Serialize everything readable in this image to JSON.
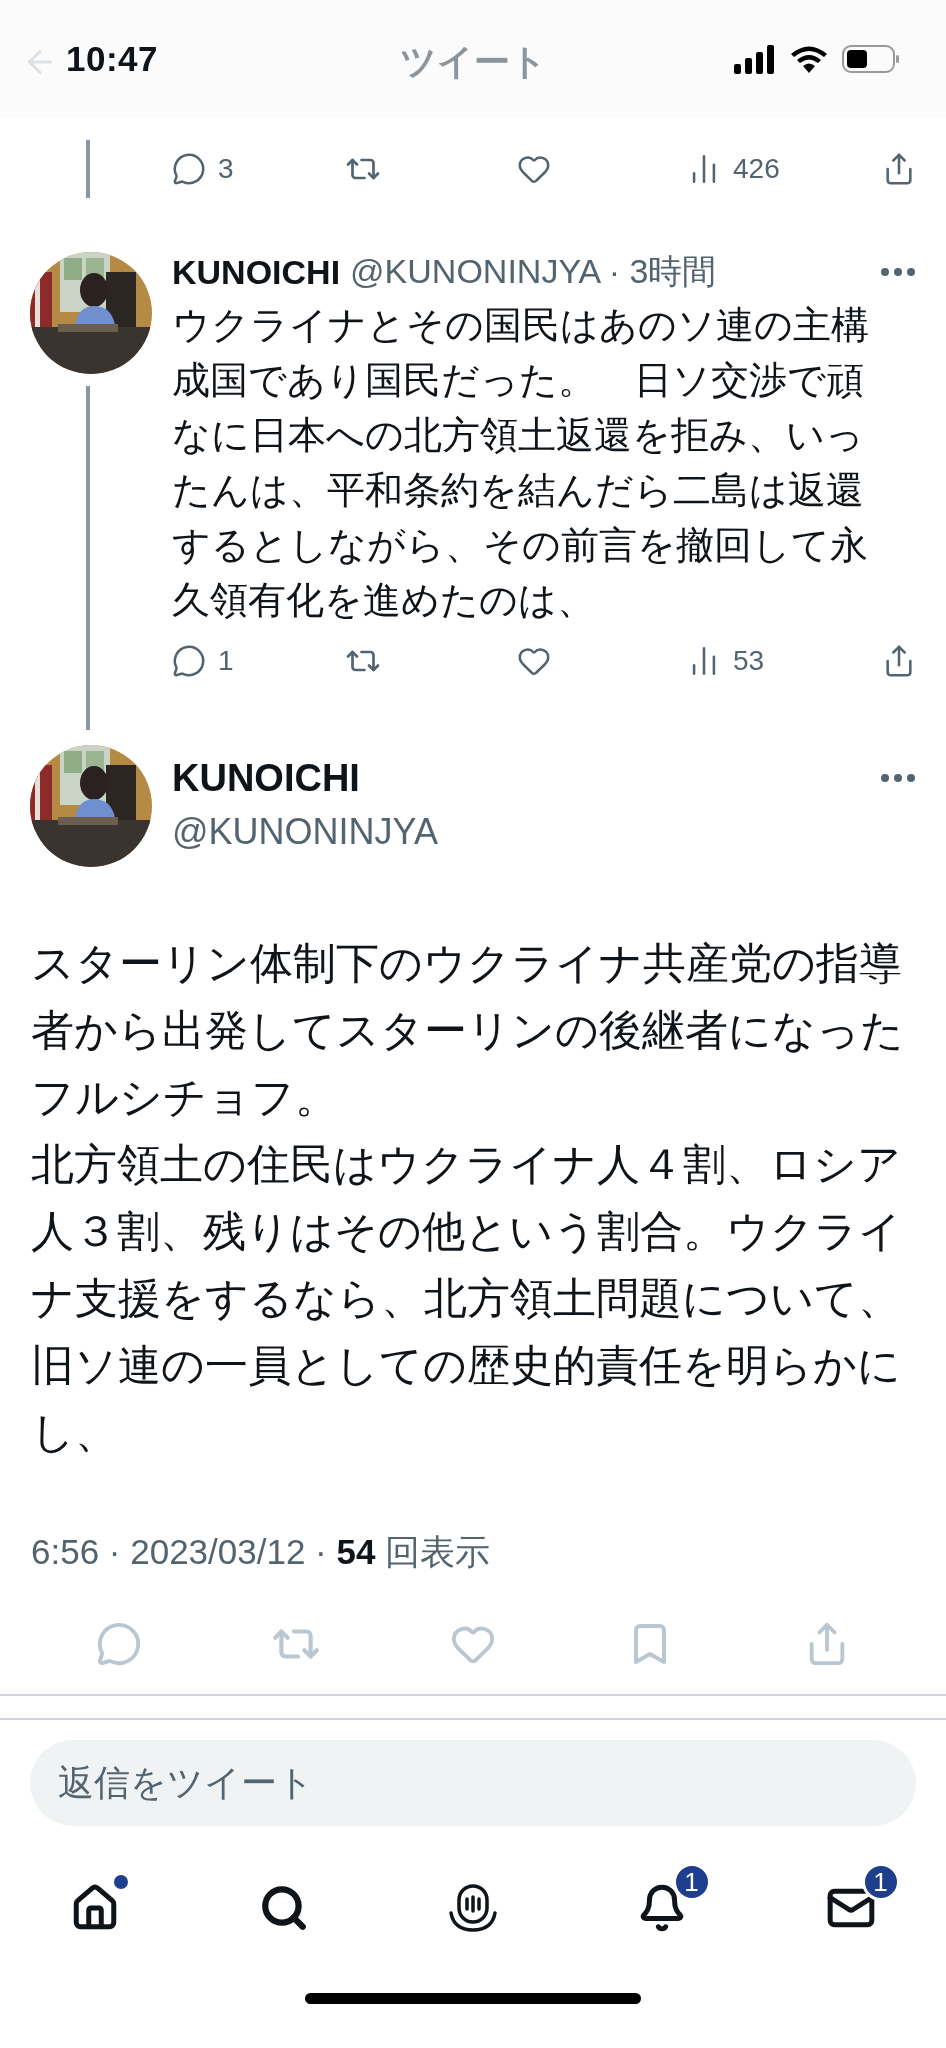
{
  "status_bar": {
    "time": "10:47"
  },
  "header": {
    "title": "ツイート"
  },
  "thread": [
    {
      "kind": "partial",
      "actions": {
        "replies": "3",
        "views": "426"
      }
    },
    {
      "kind": "reply",
      "name": "KUNOICHI",
      "meta": "@KUNONINJYA · 3時間",
      "text": "ウクライナとその国民はあのソ連の主構成国であり国民だった。　日ソ交渉で頑なに日本への北方領土返還を拒み、いったんは、平和条約を結んだら二島は返還するとしながら、その前言を撤回して永久領有化を進めたのは、",
      "actions": {
        "replies": "1",
        "views": "53"
      }
    }
  ],
  "main_tweet": {
    "name": "KUNOICHI",
    "handle": "@KUNONINJYA",
    "paragraphs": [
      "スターリン体制下のウクライナ共産党の指導者から出発してスターリンの後継者になったフルシチョフ。",
      "北方領土の住民はウクライナ人４割、ロシア人３割、残りはその他という割合。ウクライナ支援をするなら、北方領土問題について、旧ソ連の一員としての歴史的責任を明らかにし、"
    ],
    "meta": "6:56 · 2023/03/12 · **54** 回表示"
  },
  "reply_field": {
    "placeholder": "返信をツイート"
  },
  "nav": [
    {
      "kind": "home",
      "dot": true
    },
    {
      "kind": "search"
    },
    {
      "kind": "spaces"
    },
    {
      "kind": "notifications",
      "badge": "1"
    },
    {
      "kind": "messages",
      "badge": "1"
    }
  ]
}
